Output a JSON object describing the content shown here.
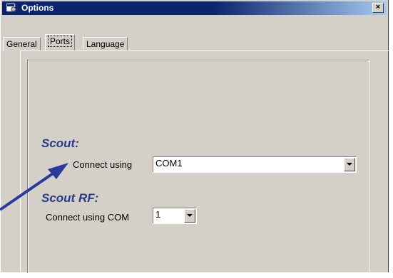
{
  "window": {
    "title": "Options",
    "close_glyph": "×"
  },
  "tabs": [
    {
      "label": "General"
    },
    {
      "label": "Ports",
      "active": true
    },
    {
      "label": "Language"
    }
  ],
  "scout": {
    "heading": "Scout:",
    "connect_label": "Connect using",
    "connect_value": "COM1"
  },
  "scout_rf": {
    "heading": "Scout RF:",
    "connect_label": "Connect using COM",
    "com_value": "1"
  },
  "colors": {
    "title_bar": "#0a246a",
    "heading": "#2a3a8c",
    "annotation_arrow": "#2a3a9c",
    "face": "#d4d0c8"
  },
  "icons": {
    "app": "options-window-icon",
    "close": "close-icon",
    "dropdown": "chevron-down-icon"
  }
}
